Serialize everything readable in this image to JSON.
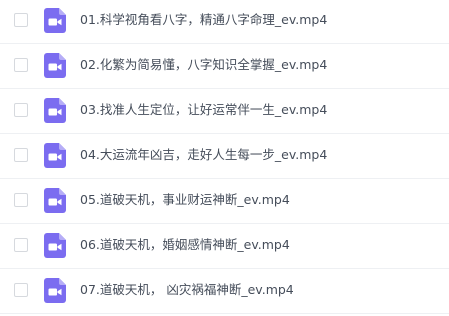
{
  "files": [
    {
      "name": "01.科学视角看八字，精通八字命理_ev.mp4",
      "icon": "video-file-icon"
    },
    {
      "name": "02.化繁为简易懂，八字知识全掌握_ev.mp4",
      "icon": "video-file-icon"
    },
    {
      "name": "03.找准人生定位，让好运常伴一生_ev.mp4",
      "icon": "video-file-icon"
    },
    {
      "name": "04.大运流年凶吉，走好人生每一步_ev.mp4",
      "icon": "video-file-icon"
    },
    {
      "name": "05.道破天机，事业财运神断_ev.mp4",
      "icon": "video-file-icon"
    },
    {
      "name": "06.道破天机，婚姻感情神断_ev.mp4",
      "icon": "video-file-icon"
    },
    {
      "name": "07.道破天机， 凶灾祸福神断_ev.mp4",
      "icon": "video-file-icon"
    }
  ],
  "colors": {
    "icon_purple": "#7b6cf0",
    "icon_fold": "#b6adf7",
    "text": "#454d5a",
    "row_divider": "#eef0f3",
    "checkbox_border": "#d6d9de"
  }
}
